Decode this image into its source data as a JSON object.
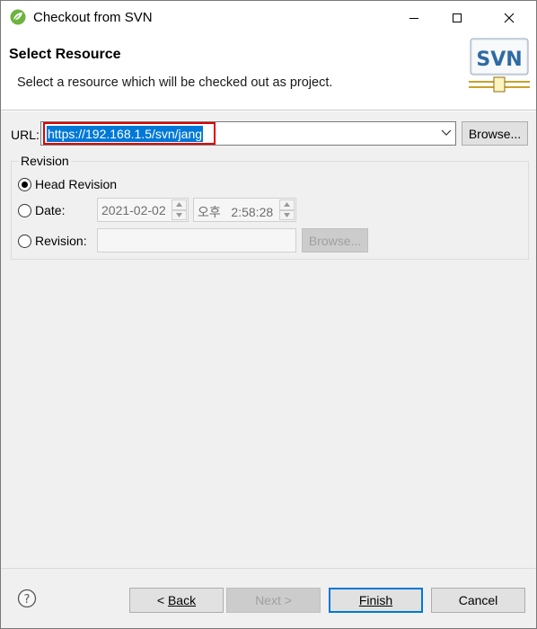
{
  "window": {
    "title": "Checkout from SVN",
    "controls": {
      "minimize": "minimize",
      "maximize": "maximize",
      "close": "close"
    }
  },
  "banner": {
    "title": "Select Resource",
    "description": "Select a resource which will be checked out as project.",
    "logo_text": "SVN"
  },
  "url": {
    "label": "URL:",
    "value": "https://192.168.1.5/svn/jang",
    "browse_label": "Browse..."
  },
  "revision": {
    "group_title": "Revision",
    "head_label": "Head Revision",
    "date_label": "Date:",
    "date_value": "2021-02-02",
    "time_value": "오후   2:58:28",
    "revision_label": "Revision:",
    "revision_value": "",
    "browse_label": "Browse...",
    "selected": "head"
  },
  "footer": {
    "back_prefix": "< ",
    "back_label": "Back",
    "next_label": "Next >",
    "finish_label": "Finish",
    "cancel_label": "Cancel"
  },
  "colors": {
    "selection": "#0078d7",
    "highlight_box": "#e00000",
    "dialog_bg": "#f0f0f0"
  }
}
